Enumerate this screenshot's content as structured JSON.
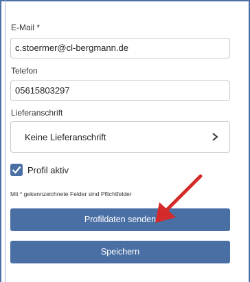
{
  "form": {
    "email": {
      "label": "E-Mail  *",
      "value": "c.stoermer@cl-bergmann.de"
    },
    "phone": {
      "label": "Telefon",
      "value": "05615803297"
    },
    "shipping": {
      "label": "Lieferanschrift",
      "value": "Keine Lieferanschrift"
    },
    "profile_active": {
      "label": "Profil aktiv",
      "checked": true
    },
    "required_hint": "Mit * gekennzeichnete Felder sind Pflichtfelder"
  },
  "buttons": {
    "send_profile": "Profildaten senden",
    "save": "Speichern"
  },
  "colors": {
    "primary": "#4a6fa5",
    "annotation_arrow": "#d42a2a"
  },
  "icons": {
    "chevron": "chevron-right-icon",
    "checkmark": "checkmark-icon",
    "arrow": "red-arrow-annotation"
  }
}
